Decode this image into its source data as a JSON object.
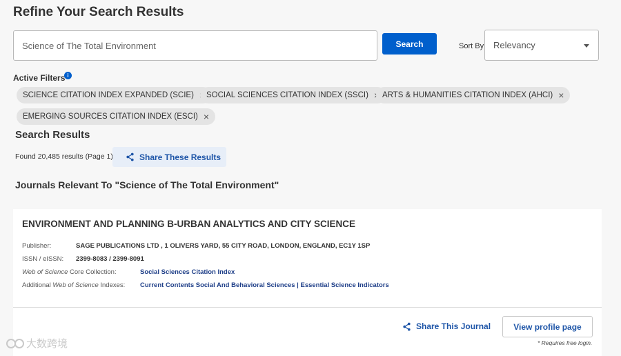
{
  "page": {
    "title": "Refine Your Search Results"
  },
  "search": {
    "value": "Science of The Total Environment",
    "button_label": "Search"
  },
  "sort": {
    "label": "Sort By:",
    "selected": "Relevancy"
  },
  "filters": {
    "label": "Active Filters",
    "chips": [
      "SCIENCE CITATION INDEX EXPANDED (SCIE)",
      "SOCIAL SCIENCES CITATION INDEX (SSCI)",
      "ARTS & HUMANITIES CITATION INDEX (AHCI)",
      "EMERGING SOURCES CITATION INDEX (ESCI)"
    ]
  },
  "results": {
    "title": "Search Results",
    "found_text": "Found 20,485 results (Page 1)",
    "share_label": "Share These Results"
  },
  "journals": {
    "title": "Journals Relevant To \"Science of The Total Environment\""
  },
  "journal": {
    "name": "ENVIRONMENT AND PLANNING B-URBAN ANALYTICS AND CITY SCIENCE",
    "publisher_label": "Publisher:",
    "publisher": "SAGE PUBLICATIONS LTD , 1 OLIVERS YARD, 55 CITY ROAD, LONDON, ENGLAND, EC1Y 1SP",
    "issn_label": "ISSN / eISSN:",
    "issn": "2399-8083 / 2399-8091",
    "core_label": "Web of Science Core Collection:",
    "core": "Social Sciences Citation Index",
    "additional_label": "Additional Web of Science Indexes:",
    "additional": "Current Contents Social And Behavioral Sciences | Essential Science Indicators",
    "share_label": "Share This Journal",
    "profile_label": "View profile page",
    "profile_note": "* Requires free login."
  },
  "watermark": {
    "text": "大数跨境"
  },
  "colors": {
    "accent": "#005fcc",
    "link": "#1f56a8"
  }
}
